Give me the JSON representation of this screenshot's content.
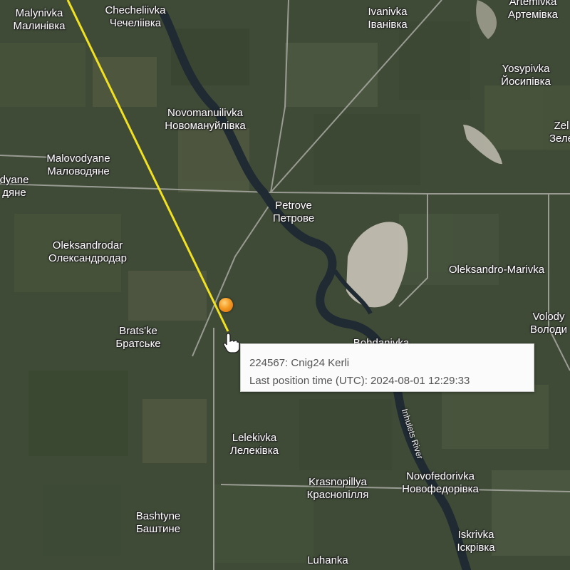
{
  "labels": [
    {
      "id": "malynivka",
      "latin": "Malynivka",
      "cyr": "Малинівка"
    },
    {
      "id": "chechelivka",
      "latin": "Checheliivka",
      "cyr": "Чечеліівка"
    },
    {
      "id": "ivanivka",
      "latin": "Ivanivka",
      "cyr": "Іванівка"
    },
    {
      "id": "artemivka",
      "latin": "Artemivka",
      "cyr": "Артемівка"
    },
    {
      "id": "yosypivka",
      "latin": "Yosypivka",
      "cyr": "Йосипівка"
    },
    {
      "id": "novomanuilivka",
      "latin": "Novomanuilivka",
      "cyr": "Новомануйлівка"
    },
    {
      "id": "zel",
      "latin": "Zel",
      "cyr": "Зеле"
    },
    {
      "id": "malovodyane",
      "latin": "Malovodyane",
      "cyr": "Маловодяне"
    },
    {
      "id": "dyane",
      "latin": "dyane",
      "cyr": "дяне"
    },
    {
      "id": "petrove",
      "latin": "Petrove",
      "cyr": "Петрове"
    },
    {
      "id": "oleksandrodar",
      "latin": "Oleksandrodar",
      "cyr": "Олександродар"
    },
    {
      "id": "oleksandro-marivka",
      "latin": "Oleksandro-Marivka",
      "cyr": ""
    },
    {
      "id": "volody",
      "latin": "Volody",
      "cyr": "Володи"
    },
    {
      "id": "bratske",
      "latin": "Brats'ke",
      "cyr": "Братське"
    },
    {
      "id": "bohdanivka",
      "latin": "Bohdanivka",
      "cyr": ""
    },
    {
      "id": "lelekivka",
      "latin": "Lelekivka",
      "cyr": "Лелеківка"
    },
    {
      "id": "krasnopillya",
      "latin": "Krasnopillya",
      "cyr": "Краснопілля"
    },
    {
      "id": "novofedorivka",
      "latin": "Novofedorivka",
      "cyr": "Новофедорівка"
    },
    {
      "id": "bashtyne",
      "latin": "Bashtyne",
      "cyr": "Баштине"
    },
    {
      "id": "iskrivka",
      "latin": "Iskrivka",
      "cyr": "Іскрівка"
    },
    {
      "id": "luhanka",
      "latin": "Luhanka",
      "cyr": ""
    }
  ],
  "river_label": "Inhulets River",
  "popup": {
    "id_line": "224567: Cnig24 Kerli",
    "time_line": "Last position time (UTC): 2024-08-01 12:29:33"
  },
  "colors": {
    "track": "#f2e21c",
    "marker": "#f59a22",
    "river": "#1f2a33",
    "terrain": "#3e4a36"
  },
  "icons": [
    "location-marker-icon",
    "hand-pointer-icon"
  ]
}
